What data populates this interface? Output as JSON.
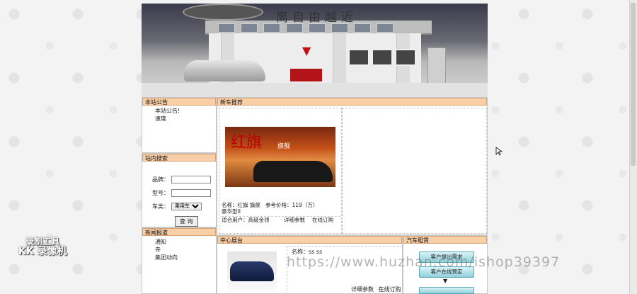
{
  "banner": {
    "slogan": "离自由越近"
  },
  "notice": {
    "title": "本站公告",
    "items": [
      "本站公告!",
      "速度"
    ]
  },
  "search": {
    "title": "站内搜索",
    "brand_label": "品牌：",
    "model_label": "型号：",
    "type_label": "车类：",
    "type_selected": "乘用车",
    "submit": "查  询"
  },
  "news": {
    "title": "新闻报道",
    "items": [
      "通知",
      "寺",
      "集团动向"
    ]
  },
  "newcar": {
    "title": "新车推荐",
    "image_text": "红旗",
    "image_tag": "旗舰",
    "name": "名称：红旗 旗舰豪华型II",
    "price": "参考价格：119（万）",
    "users": "适合用户：高级金领",
    "details": "详细参数",
    "order": "在线订购"
  },
  "center": {
    "title": "中心展台",
    "name_label": "名称：",
    "name_value": "ss ss",
    "details": "详细参数",
    "order": "在线订购"
  },
  "rental": {
    "title": "汽车租赁",
    "btn1": "客户提出需求",
    "btn2": "客户在线预定",
    "arrow": "▼"
  },
  "watermark": "https://www.huzhan.com/ishop39397",
  "recorder": {
    "line1": "录制工具",
    "line2": "KK 录像机"
  }
}
